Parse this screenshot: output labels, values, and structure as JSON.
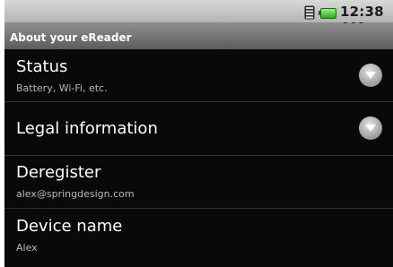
{
  "status_bar": {
    "time": "12:38 AM",
    "icons": [
      "signal-icon",
      "battery-icon"
    ],
    "battery_color": "#3cc22b"
  },
  "title_bar": {
    "title": "About your eReader"
  },
  "list": {
    "items": [
      {
        "title": "Status",
        "summary": "Battery, Wi-Fi, etc.",
        "expander_icon": "chevron-down-circle-icon"
      },
      {
        "title": "Legal information",
        "summary": "",
        "expander_icon": "chevron-down-circle-icon"
      },
      {
        "title": "Deregister",
        "summary": "alex@springdesign.com"
      },
      {
        "title": "Device name",
        "summary": "Alex"
      }
    ]
  },
  "colors": {
    "list_background": "#090909",
    "primary_text": "#ffffff",
    "secondary_text": "#b8b8b8",
    "title_bar": "#6f6f6f"
  }
}
